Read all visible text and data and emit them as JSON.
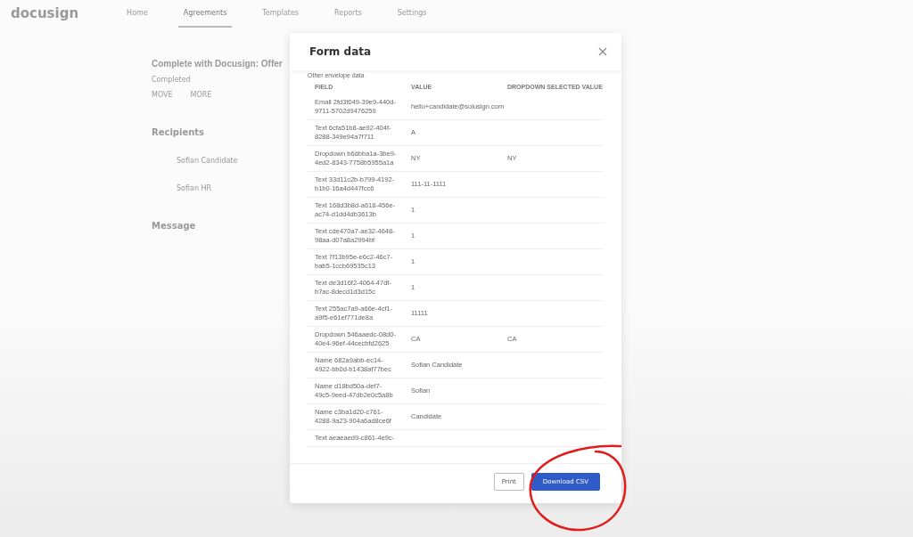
{
  "app": {
    "logo": "docusign",
    "nav": [
      {
        "label": "Home",
        "selected": false
      },
      {
        "label": "Agreements",
        "selected": true
      },
      {
        "label": "Templates",
        "selected": false
      },
      {
        "label": "Reports",
        "selected": false
      },
      {
        "label": "Settings",
        "selected": false
      }
    ]
  },
  "envelope": {
    "title": "Complete with Docusign: Offer",
    "status": "Completed",
    "actions": [
      "MOVE",
      "MORE"
    ],
    "recipients_heading": "Recipients",
    "recipients": [
      "Sofian Candidate",
      "Sofian HR"
    ],
    "message_heading": "Message"
  },
  "modal": {
    "title": "Form data",
    "section": "Other envelope data",
    "columns": [
      "FIELD",
      "VALUE",
      "DROPDOWN SELECTED VALUE"
    ],
    "rows": [
      [
        "Email 2fd3f049-39e9-440d-9711-5702d9476259",
        "hello+candidate@solusign.com",
        ""
      ],
      [
        "Text 6cfa51b8-ae92-404f-8288-349e94a7f711",
        "A",
        ""
      ],
      [
        "Dropdown b6dbba1a-3be9-4ed2-8343-7758b5955a1a",
        "NY",
        "NY"
      ],
      [
        "Text 33d11c2b-b799-4192-b1b0-16a4d447fcc6",
        "111-11-1111",
        ""
      ],
      [
        "Text 168d3b8d-a618-456e-ac74-d1dd4db3613b",
        "1",
        ""
      ],
      [
        "Text cde470a7-ae32-4648-98aa-d07a8a2994bf",
        "1",
        ""
      ],
      [
        "Text 7f13b95e-e6c2-46c7-bab5-1ccb69535c13",
        "1",
        ""
      ],
      [
        "Text de3d16f2-4064-47df-b7ac-8decd1d3d15c",
        "1",
        ""
      ],
      [
        "Text 255ac7a9-a66e-4cf1-a9f5-e61ef771de8a",
        "11111",
        ""
      ],
      [
        "Dropdown 546aaedc-08d0-40e4-96ef-44cecbfd2625",
        "CA",
        "CA"
      ],
      [
        "Name 682a9abb-ec14-4922-bb0d-b1438af77bec",
        "Sofian Candidate",
        ""
      ],
      [
        "Name d18bd50a-def7-49c5-9eed-47db2e0c5a8b",
        "Sofian",
        ""
      ],
      [
        "Name c3ba1d20-c761-4288-9a23-904a6ad8ce6f",
        "Candidate",
        ""
      ],
      [
        "Text aeaeaed9-c861-4e9c-",
        "",
        ""
      ]
    ],
    "buttons": [
      {
        "label": "Print",
        "kind": "secondary"
      },
      {
        "label": "Download CSV",
        "kind": "primary"
      }
    ]
  }
}
